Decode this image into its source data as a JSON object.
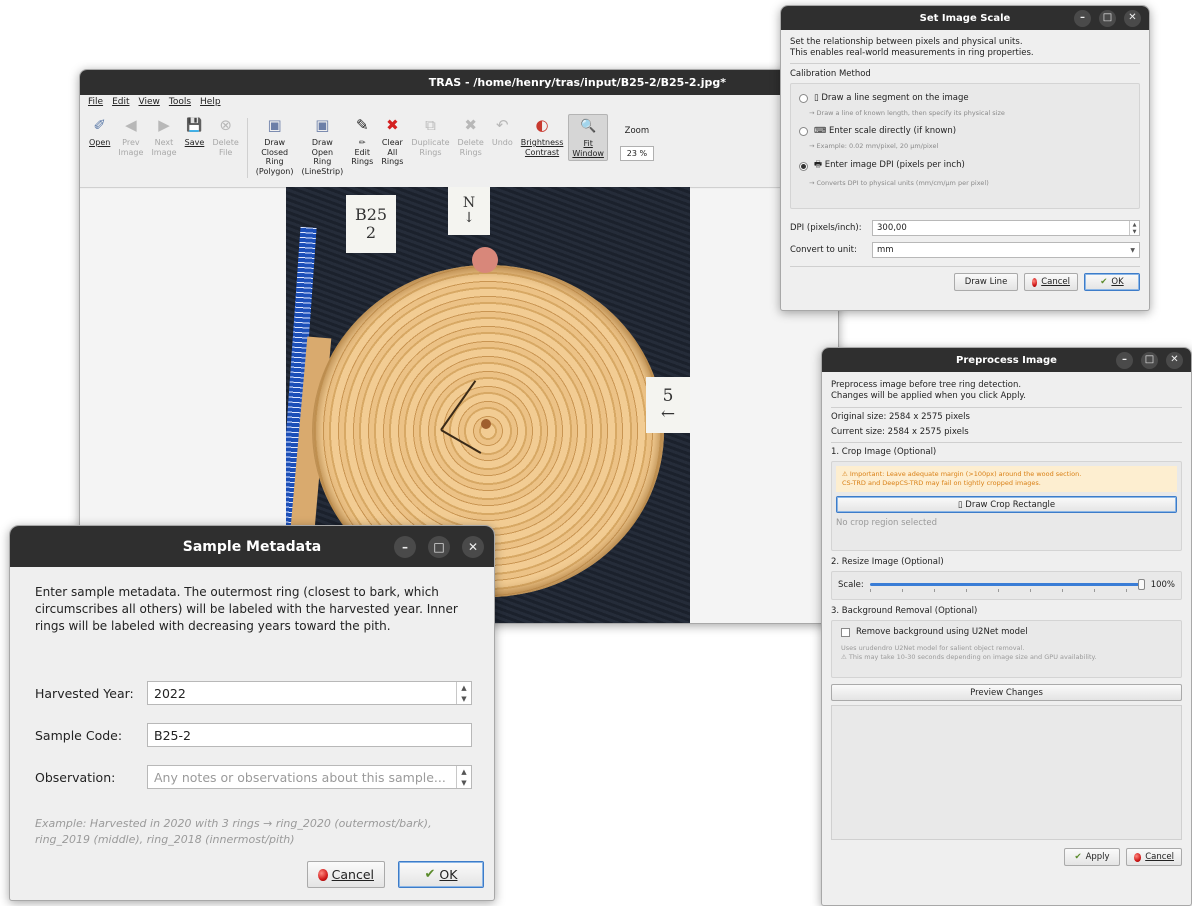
{
  "tras": {
    "title": "TRAS - /home/henry/tras/input/B25-2/B25-2.jpg*",
    "menu": [
      "File",
      "Edit",
      "View",
      "Tools",
      "Help"
    ],
    "tools": [
      {
        "label": "Open",
        "icon": "✐"
      },
      {
        "label": "Prev\nImage",
        "icon": "◀"
      },
      {
        "label": "Next\nImage",
        "icon": "▶"
      },
      {
        "label": "Save",
        "icon": "💾"
      },
      {
        "label": "Delete\nFile",
        "icon": "⊗"
      },
      {
        "label": "Draw\nClosed\nRing\n(Polygon)",
        "icon": "▣"
      },
      {
        "label": "Draw\nOpen\nRing\n(LineStrip)",
        "icon": "▣"
      },
      {
        "label": "✏\nEdit\nRings",
        "icon": "✎"
      },
      {
        "label": "Clear\nAll\nRings",
        "icon": "✖"
      },
      {
        "label": "Duplicate\nRings",
        "icon": "⧉"
      },
      {
        "label": "Delete\nRings",
        "icon": "✖"
      },
      {
        "label": "Undo",
        "icon": "↶"
      },
      {
        "label": "Brightness\nContrast",
        "icon": "◐"
      },
      {
        "label": "Fit\nWindow",
        "icon": "🔍"
      }
    ],
    "zoom_label": "Zoom",
    "zoom_value": "23 %",
    "photo_labels": {
      "card1": "B25\n2",
      "card2": "N\n↓",
      "card3": "5\n←"
    }
  },
  "scale": {
    "title": "Set Image Scale",
    "intro": "Set the relationship between pixels and physical units.\nThis enables real-world measurements in ring properties.",
    "method_title": "Calibration Method",
    "options": [
      {
        "label": "▯ Draw a line segment on the image",
        "hint": "→ Draw a line of known length, then specify its physical size",
        "selected": false
      },
      {
        "label": "⌨ Enter scale directly (if known)",
        "hint": "→ Example: 0.02 mm/pixel, 20 µm/pixel",
        "selected": false
      },
      {
        "label": "🖶 Enter image DPI (pixels per inch)",
        "hint": "→ Converts DPI to physical units (mm/cm/µm per pixel)",
        "selected": true
      }
    ],
    "dpi_label": "DPI (pixels/inch):",
    "dpi_value": "300,00",
    "unit_label": "Convert to unit:",
    "unit_value": "mm",
    "buttons": {
      "draw_line": "Draw Line",
      "cancel": "Cancel",
      "ok": "OK"
    }
  },
  "preprocess": {
    "title": "Preprocess Image",
    "intro": "Preprocess image before tree ring detection.\nChanges will be applied when you click Apply.",
    "original_size": "Original size:  2584 x 2575 pixels",
    "current_size": "Current size:  2584 x 2575 pixels",
    "crop_title": "1. Crop Image (Optional)",
    "crop_warning": "⚠ Important: Leave adequate margin (>100px) around the wood section.\nCS-TRD and DeepCS-TRD may fail on tightly cropped images.",
    "crop_button": "▯ Draw Crop Rectangle",
    "crop_status": "No crop region selected",
    "resize_title": "2. Resize Image (Optional)",
    "scale_label": "Scale:",
    "scale_value": "100%",
    "scale_fraction": 1.0,
    "bg_title": "3. Background Removal (Optional)",
    "bg_checkbox": "Remove background using U2Net model",
    "bg_hint": "Uses urudendro U2Net model for salient object removal.\n⚠ This may take 10-30 seconds depending on image size and GPU availability.",
    "preview_button": "Preview Changes",
    "apply": "Apply",
    "cancel": "Cancel"
  },
  "meta": {
    "title": "Sample Metadata",
    "intro": "Enter sample metadata. The outermost ring (closest to bark, which circumscribes all others) will be labeled with the harvested year. Inner rings will be labeled with decreasing years toward the pith.",
    "year_label": "Harvested Year:",
    "year_value": "2022",
    "code_label": "Sample Code:",
    "code_value": "B25-2",
    "obs_label": "Observation:",
    "obs_placeholder": "Any notes or observations about this sample...",
    "example": "Example: Harvested in 2020 with 3 rings → ring_2020 (outermost/bark), ring_2019 (middle), ring_2018 (innermost/pith)",
    "cancel": "Cancel",
    "ok": "OK"
  },
  "window_buttons": {
    "minimize": "–",
    "maximize": "□",
    "close": "✕"
  },
  "colors": {
    "titlebar": "#2f2f2f",
    "accent": "#3a7dd6",
    "warning": "#d98016"
  }
}
